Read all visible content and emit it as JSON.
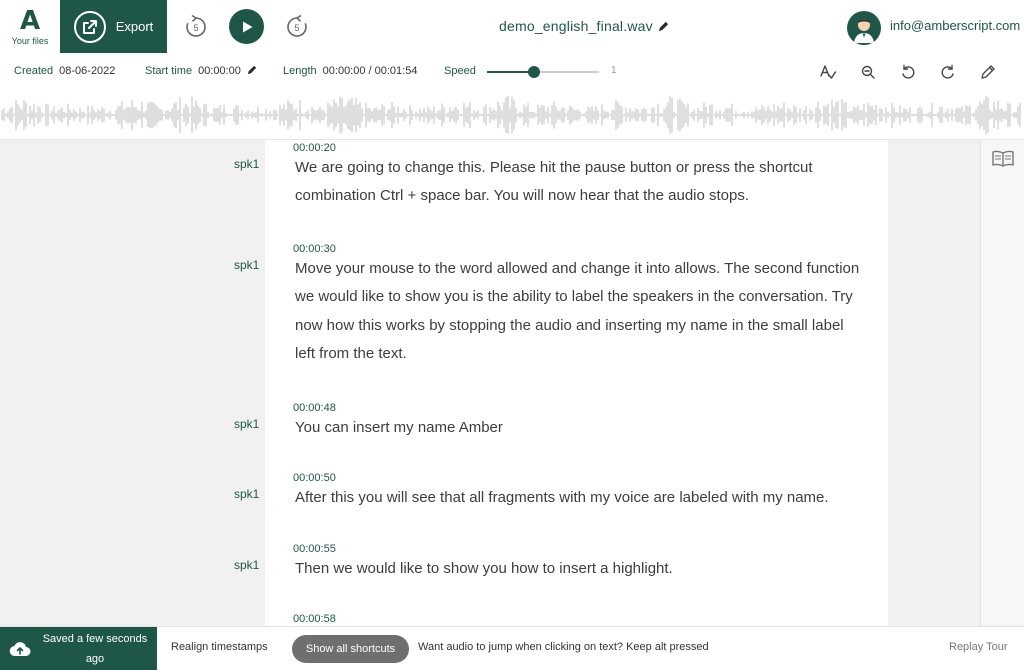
{
  "app": {
    "logo_letter": "A",
    "logo_label": "Your files"
  },
  "toolbar": {
    "export_label": "Export",
    "rewind_seconds": "5",
    "forward_seconds": "5",
    "filename": "demo_english_final.wav",
    "user_email": "info@amberscript.com"
  },
  "info": {
    "created_label": "Created",
    "created_value": "08-06-2022",
    "start_label": "Start time",
    "start_value": "00:00:00",
    "length_label": "Length",
    "length_value": "00:00:00 / 00:01:54",
    "speed_label": "Speed",
    "speed_value": "1",
    "speed_fraction": 0.42
  },
  "transcript": [
    {
      "speaker": "spk1",
      "time": "00:00:20",
      "text": "We are going to change this. Please hit the pause button or press the shortcut combination Ctrl + space bar. You will now hear that the audio stops."
    },
    {
      "speaker": "spk1",
      "time": "00:00:30",
      "text": "Move your mouse to the word allowed and change it into allows. The second function we would like to show you is the ability to label the speakers in the conversation. Try now how this works by stopping the audio and inserting my name in the small label left from the text."
    },
    {
      "speaker": "spk1",
      "time": "00:00:48",
      "text": "You can insert my name Amber"
    },
    {
      "speaker": "spk1",
      "time": "00:00:50",
      "text": "After this you will see that all fragments with my voice are labeled with my name."
    },
    {
      "speaker": "spk1",
      "time": "00:00:55",
      "text": "Then we would like to show you how to insert a highlight."
    },
    {
      "speaker": "spk1",
      "time": "00:00:58",
      "text": ""
    }
  ],
  "footer": {
    "saved_status": "Saved a few seconds ago",
    "realign_label": "Realign timestamps",
    "shortcuts_label": "Show all shortcuts",
    "hint_text": "Want audio to jump when clicking on text? Keep alt pressed",
    "replay_label": "Replay Tour"
  },
  "colors": {
    "brand": "#1e5747",
    "waveform": "#c9c9c9",
    "background": "#f1f1f1"
  },
  "icons": [
    "export-icon",
    "rewind-icon",
    "play-icon",
    "forward-icon",
    "edit-pencil-icon",
    "spellcheck-icon",
    "search-replace-icon",
    "undo-icon",
    "redo-icon",
    "pencil-icon",
    "book-icon",
    "cloud-upload-icon"
  ]
}
